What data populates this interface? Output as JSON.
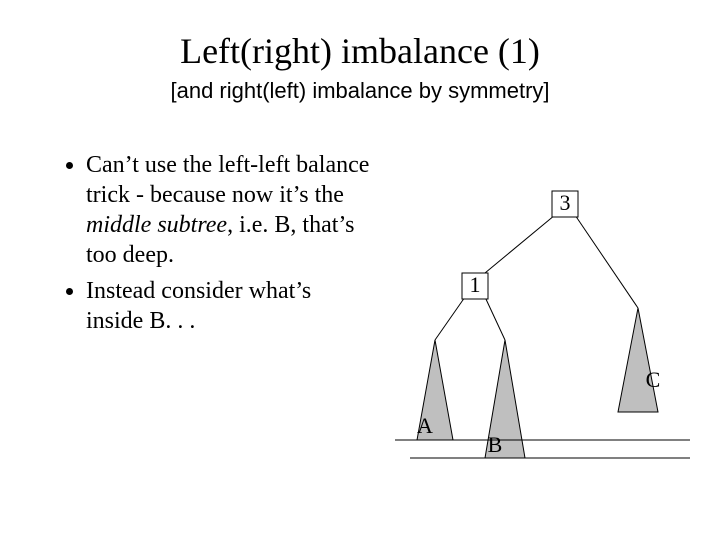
{
  "title": "Left(right) imbalance (1)",
  "subtitle": "[and right(left) imbalance by symmetry]",
  "bullets": {
    "b1_pre": "Can’t use the left-left balance trick - because now it’s the ",
    "b1_mid": "middle subtree",
    "b1_post": ", i.e. B, that’s too deep.",
    "b2": "Instead consider what’s inside B. . ."
  },
  "diagram": {
    "node3": "3",
    "node1": "1",
    "triA": "A",
    "triB": "B",
    "triC": "C"
  }
}
